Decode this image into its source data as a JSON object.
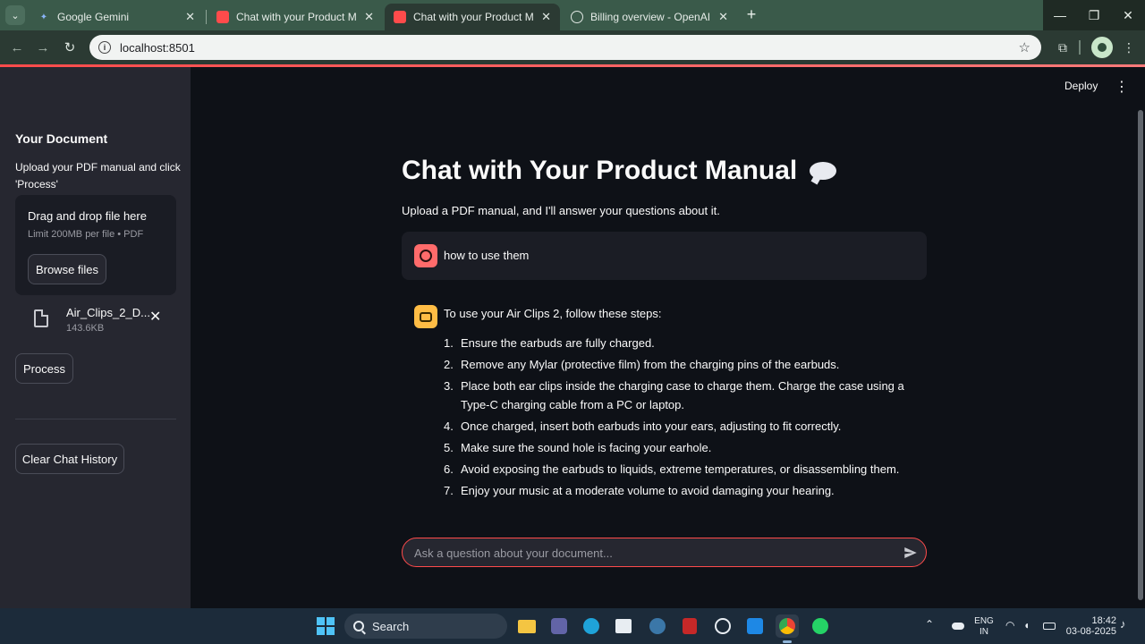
{
  "browser": {
    "tabs": [
      {
        "title": "Google Gemini",
        "active": false
      },
      {
        "title": "Chat with your Product Manual",
        "active": false
      },
      {
        "title": "Chat with your Product Manual",
        "active": true
      },
      {
        "title": "Billing overview - OpenAI API",
        "active": false
      }
    ],
    "url": "localhost:8501",
    "accent_color": "#ff4b4b"
  },
  "sidebar": {
    "title": "Your Document",
    "description": "Upload your PDF manual and click 'Process'",
    "dropzone": {
      "title": "Drag and drop file here",
      "limit": "Limit 200MB per file • PDF",
      "browse_label": "Browse files"
    },
    "file": {
      "name": "Air_Clips_2_D...",
      "size": "143.6KB"
    },
    "process_label": "Process",
    "clear_label": "Clear Chat History"
  },
  "header": {
    "deploy_label": "Deploy"
  },
  "main": {
    "title": "Chat with Your Product Manual",
    "subtitle": "Upload a PDF manual, and I'll answer your questions about it.",
    "user_message": "how to use them",
    "assistant": {
      "intro": "To use your Air Clips 2, follow these steps:",
      "steps": [
        "Ensure the earbuds are fully charged.",
        "Remove any Mylar (protective film) from the charging pins of the earbuds.",
        "Place both ear clips inside the charging case to charge them. Charge the case using a Type-C charging cable from a PC or laptop.",
        "Once charged, insert both earbuds into your ears, adjusting to fit correctly.",
        "Make sure the sound hole is facing your earhole.",
        "Avoid exposing the earbuds to liquids, extreme temperatures, or disassembling them.",
        "Enjoy your music at a moderate volume to avoid damaging your hearing."
      ]
    },
    "chat_input_placeholder": "Ask a question about your document..."
  },
  "taskbar": {
    "search_label": "Search",
    "language_line1": "ENG",
    "language_line2": "IN",
    "time": "18:42",
    "date": "03-08-2025"
  }
}
